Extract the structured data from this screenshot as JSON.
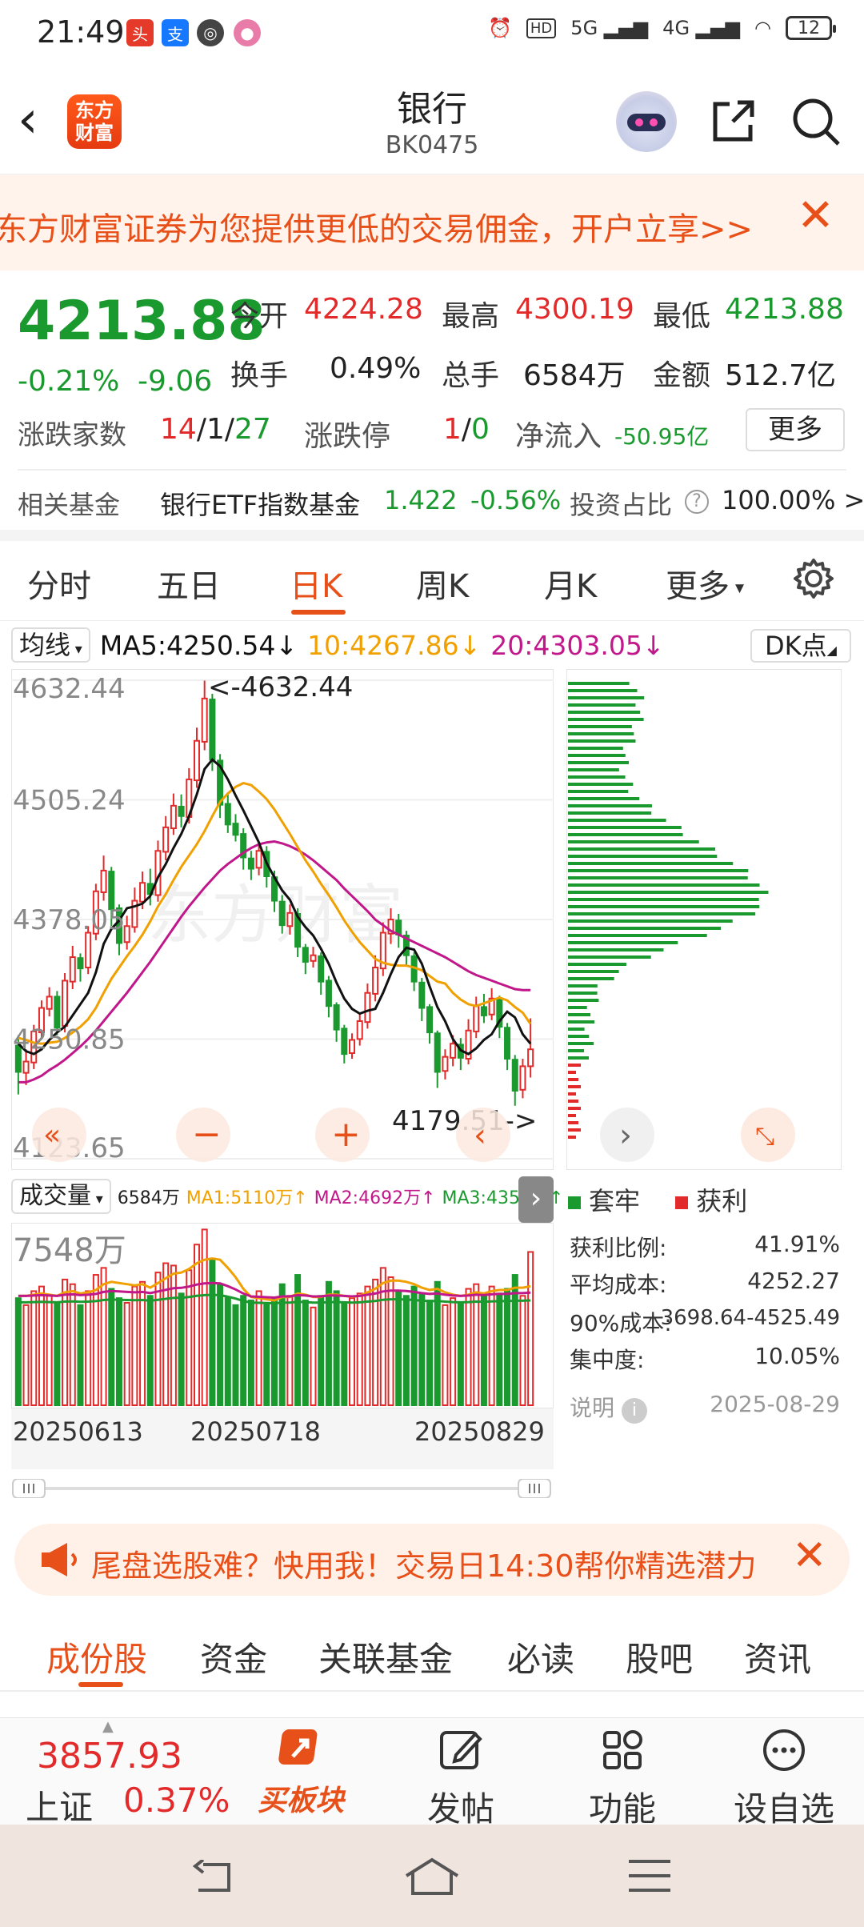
{
  "status_bar": {
    "time": "21:49",
    "signal_labels": [
      "5G",
      "4G"
    ],
    "hd_label": "HD",
    "battery": "12"
  },
  "nav": {
    "title": "银行",
    "code": "BK0475",
    "logo_text": "东方财富"
  },
  "promo_top": {
    "text": "东方财富证券为您提供更低的交易佣金，开户立享>>"
  },
  "quote": {
    "price": "4213.88",
    "change_pct": "-0.21%",
    "change_abs": "-9.06",
    "open_label": "今开",
    "open": "4224.28",
    "high_label": "最高",
    "high": "4300.19",
    "low_label": "最低",
    "low": "4213.88",
    "turnover_label": "换手",
    "turnover": "0.49%",
    "volume_label": "总手",
    "volume": "6584万",
    "amount_label": "金额",
    "amount": "512.7亿",
    "updown_label": "涨跌家数",
    "up": "14",
    "flat": "1",
    "down": "27",
    "limit_label": "涨跌停",
    "limit_up": "1",
    "limit_down": "0",
    "netflow_label": "净流入",
    "netflow": "-50.95亿",
    "more": "更多"
  },
  "fund_row": {
    "label": "相关基金",
    "name": "银行ETF指数基金",
    "price": "1.422",
    "chg": "-0.56%",
    "ratio_label": "投资占比",
    "ratio": "100.00% >"
  },
  "k_tabs": [
    "分时",
    "五日",
    "日K",
    "周K",
    "月K",
    "更多"
  ],
  "k_tab_active": 2,
  "ma": {
    "selector": "均线",
    "ma5": "MA5:4250.54",
    "ma10": "10:4267.86",
    "ma20": "20:4303.05",
    "dk": "DK点"
  },
  "colors": {
    "up": "#e22a2a",
    "down": "#1a9a2e",
    "ma5": "#111111",
    "ma10": "#f0a000",
    "ma20": "#c0178a",
    "accent": "#e8501a"
  },
  "chart_data": {
    "type": "candlestick",
    "y_ticks": [
      "4632.44",
      "4505.24",
      "4378.05",
      "4250.85",
      "4123.65"
    ],
    "ylim": [
      4123.65,
      4632.44
    ],
    "max_label": "<-4632.44",
    "min_label": "4179.51->",
    "x_ticks": [
      "20250613",
      "20250718",
      "20250829"
    ],
    "candles": [
      [
        4244,
        4216,
        4255,
        4192
      ],
      [
        4215,
        4227,
        4240,
        4202
      ],
      [
        4226,
        4259,
        4266,
        4219
      ],
      [
        4258,
        4284,
        4292,
        4251
      ],
      [
        4283,
        4296,
        4306,
        4275
      ],
      [
        4296,
        4263,
        4302,
        4255
      ],
      [
        4265,
        4313,
        4321,
        4258
      ],
      [
        4312,
        4338,
        4350,
        4304
      ],
      [
        4337,
        4326,
        4342,
        4312
      ],
      [
        4327,
        4364,
        4371,
        4320
      ],
      [
        4363,
        4408,
        4416,
        4356
      ],
      [
        4407,
        4430,
        4446,
        4398
      ],
      [
        4429,
        4389,
        4434,
        4371
      ],
      [
        4390,
        4353,
        4394,
        4340
      ],
      [
        4354,
        4371,
        4382,
        4346
      ],
      [
        4370,
        4398,
        4412,
        4364
      ],
      [
        4397,
        4417,
        4429,
        4389
      ],
      [
        4416,
        4405,
        4432,
        4393
      ],
      [
        4404,
        4451,
        4462,
        4397
      ],
      [
        4450,
        4476,
        4488,
        4441
      ],
      [
        4475,
        4499,
        4512,
        4468
      ],
      [
        4498,
        4488,
        4511,
        4476
      ],
      [
        4487,
        4527,
        4539,
        4480
      ],
      [
        4526,
        4568,
        4582,
        4518
      ],
      [
        4567,
        4613,
        4632,
        4558
      ],
      [
        4612,
        4548,
        4618,
        4536
      ],
      [
        4547,
        4500,
        4554,
        4486
      ],
      [
        4501,
        4479,
        4512,
        4470
      ],
      [
        4480,
        4468,
        4490,
        4461
      ],
      [
        4469,
        4444,
        4475,
        4431
      ],
      [
        4443,
        4432,
        4451,
        4420
      ],
      [
        4433,
        4451,
        4458,
        4425
      ],
      [
        4450,
        4424,
        4456,
        4412
      ],
      [
        4423,
        4398,
        4430,
        4386
      ],
      [
        4397,
        4372,
        4404,
        4363
      ],
      [
        4371,
        4385,
        4394,
        4362
      ],
      [
        4384,
        4349,
        4390,
        4338
      ],
      [
        4348,
        4333,
        4352,
        4320
      ],
      [
        4334,
        4340,
        4349,
        4327
      ],
      [
        4339,
        4312,
        4343,
        4298
      ],
      [
        4313,
        4286,
        4318,
        4274
      ],
      [
        4287,
        4261,
        4290,
        4248
      ],
      [
        4262,
        4235,
        4266,
        4225
      ],
      [
        4236,
        4250,
        4257,
        4230
      ],
      [
        4251,
        4270,
        4279,
        4244
      ],
      [
        4269,
        4300,
        4310,
        4262
      ],
      [
        4299,
        4327,
        4340,
        4291
      ],
      [
        4326,
        4364,
        4375,
        4318
      ],
      [
        4363,
        4378,
        4390,
        4352
      ],
      [
        4377,
        4362,
        4384,
        4348
      ],
      [
        4361,
        4340,
        4366,
        4328
      ],
      [
        4339,
        4312,
        4343,
        4302
      ],
      [
        4311,
        4284,
        4316,
        4270
      ],
      [
        4285,
        4258,
        4288,
        4246
      ],
      [
        4257,
        4216,
        4260,
        4199
      ],
      [
        4217,
        4232,
        4240,
        4208
      ],
      [
        4231,
        4246,
        4255,
        4222
      ],
      [
        4245,
        4231,
        4252,
        4218
      ],
      [
        4230,
        4260,
        4272,
        4224
      ],
      [
        4259,
        4286,
        4296,
        4252
      ],
      [
        4285,
        4276,
        4299,
        4268
      ],
      [
        4277,
        4294,
        4305,
        4271
      ],
      [
        4293,
        4264,
        4297,
        4252
      ],
      [
        4263,
        4230,
        4268,
        4218
      ],
      [
        4229,
        4196,
        4234,
        4180
      ],
      [
        4197,
        4222,
        4230,
        4188
      ],
      [
        4222,
        4240,
        4273,
        4210
      ]
    ],
    "ma5": [
      4246,
      4238,
      4235,
      4240,
      4250,
      4258,
      4264,
      4276,
      4288,
      4300,
      4322,
      4352,
      4368,
      4377,
      4390,
      4392,
      4395,
      4403,
      4423,
      4437,
      4454,
      4469,
      4488,
      4511,
      4538,
      4548,
      4541,
      4527,
      4510,
      4494,
      4477,
      4460,
      4438,
      4423,
      4409,
      4399,
      4381,
      4370,
      4361,
      4347,
      4331,
      4311,
      4294,
      4283,
      4278,
      4281,
      4283,
      4300,
      4320,
      4338,
      4348,
      4346,
      4331,
      4307,
      4285,
      4270,
      4251,
      4239,
      4235,
      4241,
      4250,
      4256,
      4270,
      4280,
      4274,
      4256,
      4246
    ],
    "ma10": [
      4252,
      4250,
      4247,
      4246,
      4247,
      4248,
      4252,
      4258,
      4264,
      4272,
      4284,
      4300,
      4315,
      4327,
      4339,
      4350,
      4362,
      4376,
      4392,
      4405,
      4420,
      4434,
      4446,
      4458,
      4472,
      4488,
      4503,
      4512,
      4519,
      4523,
      4521,
      4514,
      4506,
      4495,
      4482,
      4469,
      4455,
      4441,
      4429,
      4416,
      4404,
      4391,
      4377,
      4365,
      4354,
      4345,
      4336,
      4332,
      4330,
      4329,
      4329,
      4327,
      4324,
      4318,
      4312,
      4310,
      4300,
      4293,
      4288,
      4286,
      4289,
      4292,
      4295,
      4292,
      4285,
      4279,
      4267
    ],
    "ma20": [
      4205,
      4205,
      4208,
      4212,
      4218,
      4223,
      4229,
      4236,
      4243,
      4251,
      4260,
      4270,
      4280,
      4290,
      4300,
      4311,
      4322,
      4333,
      4345,
      4357,
      4369,
      4381,
      4392,
      4402,
      4412,
      4421,
      4430,
      4437,
      4443,
      4449,
      4454,
      4458,
      4460,
      4461,
      4459,
      4456,
      4452,
      4447,
      4441,
      4434,
      4427,
      4420,
      4411,
      4403,
      4395,
      4387,
      4378,
      4372,
      4366,
      4362,
      4358,
      4354,
      4350,
      4346,
      4342,
      4338,
      4333,
      4328,
      4323,
      4319,
      4316,
      4313,
      4310,
      4307,
      4304,
      4303,
      4303
    ],
    "volume_label": "7548万",
    "volumes": [
      4600,
      4300,
      4900,
      5100,
      4700,
      4400,
      5400,
      5200,
      4300,
      4900,
      5600,
      5900,
      5000,
      4600,
      4400,
      5100,
      5300,
      4700,
      5700,
      6100,
      6000,
      4800,
      5800,
      6900,
      7548,
      6300,
      5200,
      4600,
      4300,
      4700,
      4500,
      4900,
      4400,
      4600,
      5200,
      4700,
      5600,
      4500,
      4200,
      4700,
      5300,
      4900,
      4400,
      4600,
      4800,
      5100,
      5400,
      5900,
      5500,
      4900,
      4700,
      5100,
      4800,
      4500,
      5300,
      4300,
      4600,
      4400,
      5000,
      5200,
      4700,
      5100,
      4800,
      5000,
      5600,
      4700,
      6584
    ],
    "vol_ma1": [
      4700,
      4700,
      4750,
      4800,
      4750,
      4700,
      4850,
      4900,
      4800,
      4850,
      4950,
      5200,
      5300,
      5250,
      5200,
      5150,
      5200,
      5050,
      5250,
      5450,
      5650,
      5700,
      5850,
      6100,
      6250,
      6300,
      6250,
      5900,
      5500,
      5000,
      4650,
      4600,
      4550,
      4500,
      4650,
      4650,
      4800,
      4750,
      4650,
      4650,
      4750,
      4750,
      4700,
      4650,
      4700,
      4850,
      5000,
      5250,
      5350,
      5350,
      5300,
      5200,
      5050,
      4950,
      5000,
      4850,
      4750,
      4700,
      4750,
      4850,
      4800,
      4900,
      4950,
      4950,
      5050,
      5050,
      5110
    ],
    "vol_ma2": [
      4690
    ],
    "vol_ma3": [
      4350
    ]
  },
  "volume_row": {
    "selector": "成交量",
    "vol": "6584万",
    "ma1": "MA1:5110万",
    "ma2": "MA2:4692万",
    "ma3": "MA3:4352万"
  },
  "chip": {
    "legend_trapped": "套牢",
    "legend_profit": "获利",
    "stats": [
      {
        "label": "获利比例:",
        "value": "41.91%"
      },
      {
        "label": "平均成本:",
        "value": "4252.27"
      },
      {
        "label": "90%成本:",
        "value": "3698.64-4525.49"
      },
      {
        "label": "集中度:",
        "value": "10.05%"
      }
    ],
    "note": "说明",
    "date": "2025-08-29"
  },
  "promo_mid": {
    "text": "尾盘选股难？快用我！交易日14:30帮你精选潜力"
  },
  "bottom_tabs": [
    "成份股",
    "资金",
    "关联基金",
    "必读",
    "股吧",
    "资讯"
  ],
  "bottom_bar": {
    "index_value": "3857.93",
    "index_name": "上证",
    "index_change": "0.37%",
    "buy_label": "买板块",
    "post_label": "发帖",
    "func_label": "功能",
    "fav_label": "设自选"
  }
}
